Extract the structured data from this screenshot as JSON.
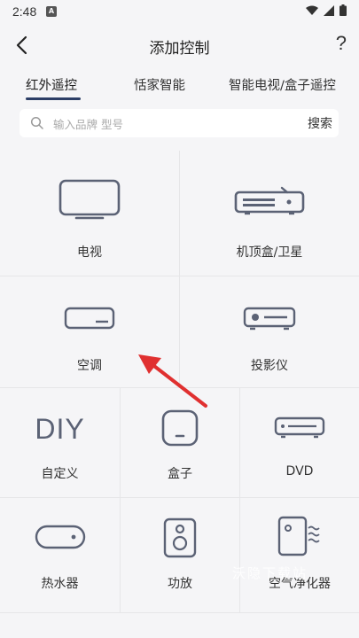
{
  "status": {
    "time": "2:48",
    "notif_letter": "A"
  },
  "header": {
    "title": "添加控制",
    "help": "?"
  },
  "tabs": [
    {
      "label": "红外遥控"
    },
    {
      "label": "恬家智能"
    },
    {
      "label": "智能电视/盒子遥控"
    }
  ],
  "search": {
    "placeholder": "输入品牌 型号",
    "button": "搜索"
  },
  "devices": {
    "tv": "电视",
    "stb": "机顶盒/卫星",
    "ac": "空调",
    "projector": "投影仪",
    "diy_icon": "DIY",
    "diy": "自定义",
    "box": "盒子",
    "dvd": "DVD",
    "heater": "热水器",
    "amp": "功放",
    "purifier": "空气净化器"
  },
  "watermark": "沃隐下载站",
  "colors": {
    "icon": "#5b6275",
    "arrow": "#e03030",
    "tab_indicator": "#2c3e66"
  }
}
